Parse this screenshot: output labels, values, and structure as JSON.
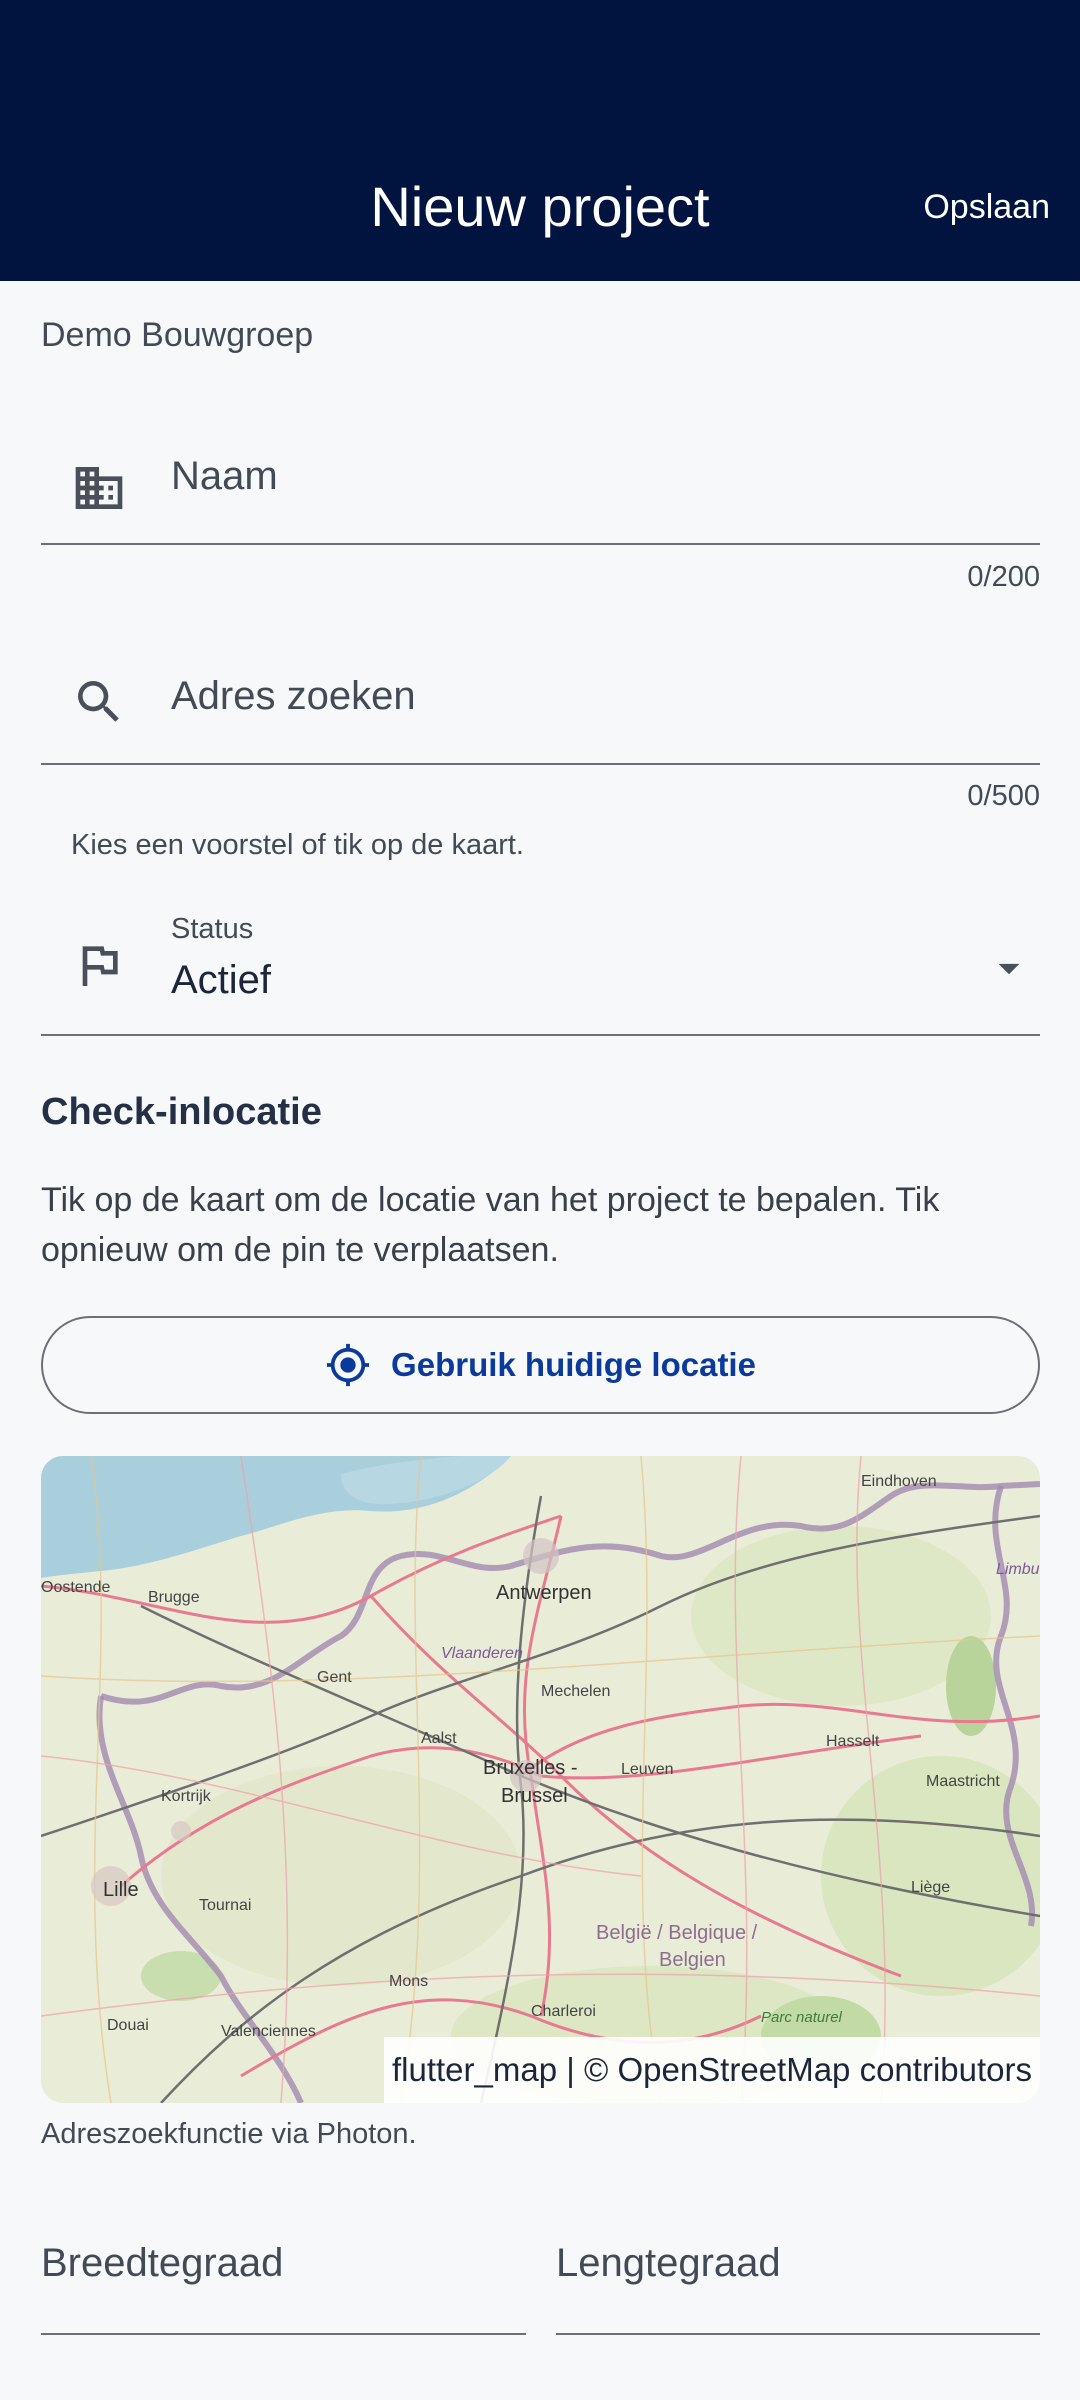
{
  "appbar": {
    "title": "Nieuw project",
    "save_label": "Opslaan"
  },
  "organization": "Demo Bouwgroep",
  "name_field": {
    "placeholder": "Naam",
    "counter": "0/200",
    "icon": "building-icon"
  },
  "address_field": {
    "placeholder": "Adres zoeken",
    "counter": "0/500",
    "helper": "Kies een voorstel of tik op de kaart.",
    "icon": "search-icon"
  },
  "status_field": {
    "label": "Status",
    "value": "Actief",
    "icon": "flag-icon"
  },
  "checkin": {
    "title": "Check-inlocatie",
    "description": "Tik op de kaart om de locatie van het project te bepalen. Tik opnieuw om de pin te verplaatsen.",
    "use_location_label": "Gebruik huidige locatie"
  },
  "map": {
    "attribution": "flutter_map | © OpenStreetMap contributors",
    "places": [
      "Eindhoven",
      "Oostende",
      "Brugge",
      "Antwerpen",
      "Vlaanderen",
      "Mechelen",
      "Gent",
      "Aalst",
      "Hasselt",
      "Bruxelles -",
      "Brussel",
      "Leuven",
      "Maastricht",
      "Kortrijk",
      "Lille",
      "Tournai",
      "Liège",
      "België / Belgique /",
      "Belgien",
      "Mons",
      "Charleroi",
      "Douai",
      "Valenciennes",
      "Parc naturel",
      "Limbu"
    ]
  },
  "geocoder_note": "Adreszoekfunctie via Photon.",
  "coordinates": {
    "lat_placeholder": "Breedtegraad",
    "lng_placeholder": "Lengtegraad"
  },
  "colors": {
    "appbar": "#011440",
    "accent": "#0a3a9c",
    "background": "#f7f8fa"
  }
}
